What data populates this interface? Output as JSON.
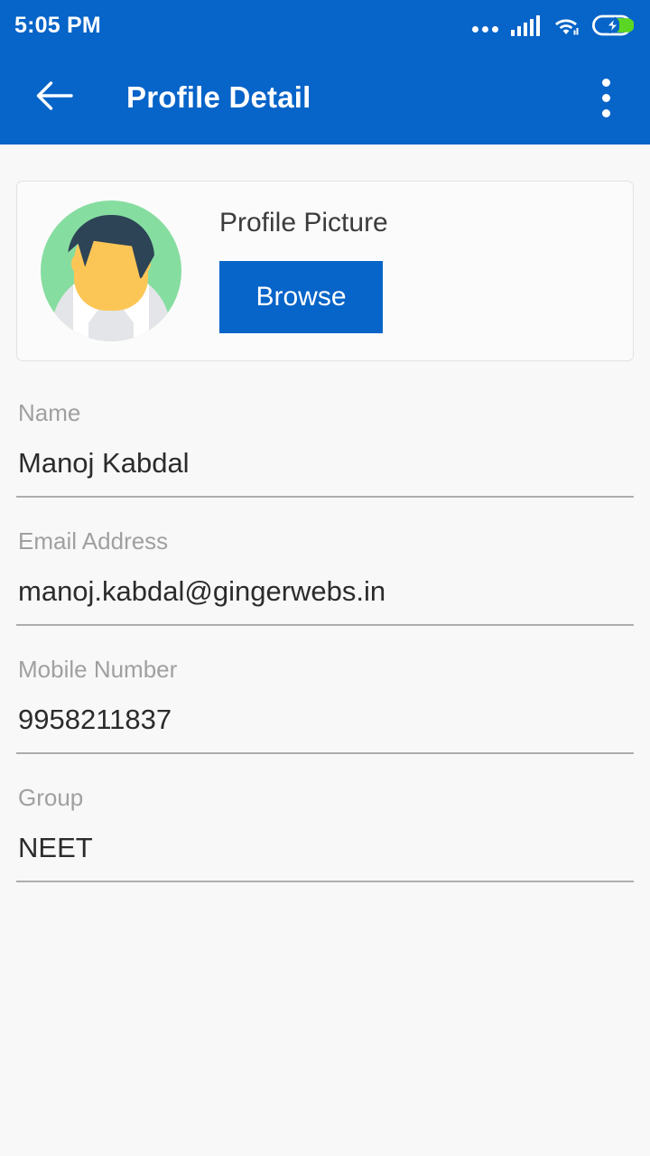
{
  "status_bar": {
    "time": "5:05 PM",
    "icons": {
      "more": "more-dots-icon",
      "signal": "cellular-signal-icon",
      "wifi": "wifi-icon",
      "battery": "battery-charging-icon"
    },
    "background_color": "#0764c8",
    "foreground_color": "#ffffff"
  },
  "app_bar": {
    "back_icon": "arrow-back-icon",
    "title": "Profile Detail",
    "overflow_icon": "overflow-menu-icon",
    "background_color": "#0764c8"
  },
  "profile_picture_card": {
    "avatar_icon": "user-avatar-illustration",
    "label": "Profile Picture",
    "browse_label": "Browse",
    "button_color": "#0764c8"
  },
  "fields": [
    {
      "label": "Name",
      "value": "Manoj Kabdal"
    },
    {
      "label": "Email Address",
      "value": "manoj.kabdal@gingerwebs.in"
    },
    {
      "label": "Mobile Number",
      "value": "9958211837"
    },
    {
      "label": "Group",
      "value": "NEET"
    }
  ],
  "theme": {
    "page_background": "#f8f8f8",
    "label_color": "#a0a0a0",
    "value_color": "#2b2b2b",
    "underline_color": "#adadad",
    "accent": "#0764c8"
  }
}
